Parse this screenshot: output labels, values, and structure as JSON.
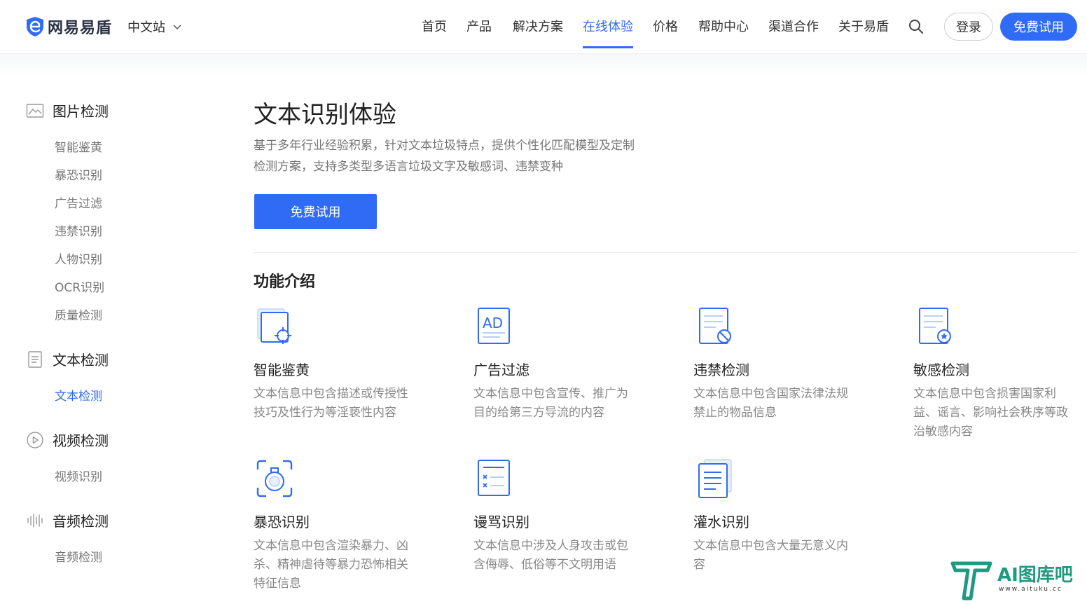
{
  "brand": {
    "logo_text": "网易易盾",
    "site_switch": "中文站"
  },
  "nav": {
    "items": [
      "首页",
      "产品",
      "解决方案",
      "在线体验",
      "价格",
      "帮助中心",
      "渠道合作",
      "关于易盾"
    ],
    "active": "在线体验",
    "login": "登录",
    "trial": "免费试用",
    "accent_color": "#2f6bf5"
  },
  "sidebar": {
    "groups": [
      {
        "label": "图片检测",
        "icon": "image-icon",
        "items": [
          "智能鉴黄",
          "暴恐识别",
          "广告过滤",
          "违禁识别",
          "人物识别",
          "OCR识别",
          "质量检测"
        ]
      },
      {
        "label": "文本检测",
        "icon": "document-icon",
        "items": [
          "文本检测"
        ]
      },
      {
        "label": "视频检测",
        "icon": "play-icon",
        "items": [
          "视频识别"
        ]
      },
      {
        "label": "音频检测",
        "icon": "audio-wave-icon",
        "items": [
          "音频检测"
        ]
      }
    ],
    "active_item": "文本检测"
  },
  "main": {
    "title": "文本识别体验",
    "description": "基于多年行业经验积累，针对文本垃圾特点，提供个性化匹配模型及定制检测方案，支持多类型多语言垃圾文字及敏感词、违禁变种",
    "trial_button": "免费试用",
    "section_title": "功能介绍",
    "features": [
      {
        "title": "智能鉴黄",
        "desc": "文本信息中包含描述或传授性技巧及性行为等淫亵性内容",
        "icon": "target-document-icon"
      },
      {
        "title": "广告过滤",
        "desc": "文本信息中包含宣传、推广为目的给第三方导流的内容",
        "icon": "ad-icon"
      },
      {
        "title": "违禁检测",
        "desc": "文本信息中包含国家法律法规禁止的物品信息",
        "icon": "forbidden-document-icon"
      },
      {
        "title": "敏感检测",
        "desc": "文本信息中包含损害国家利益、谣言、影响社会秩序等政治敏感内容",
        "icon": "star-document-icon"
      },
      {
        "title": "暴恐识别",
        "desc": "文本信息中包含渲染暴力、凶杀、精神虐待等暴力恐怖相关特征信息",
        "icon": "scan-bomb-icon"
      },
      {
        "title": "谩骂识别",
        "desc": "文本信息中涉及人身攻击或包含侮辱、低俗等不文明用语",
        "icon": "checklist-icon"
      },
      {
        "title": "灌水识别",
        "desc": "文本信息中包含大量无意义内容",
        "icon": "stacked-document-icon"
      }
    ]
  },
  "watermark": {
    "text": "AI图库吧",
    "url": "www.aituku.cc"
  }
}
